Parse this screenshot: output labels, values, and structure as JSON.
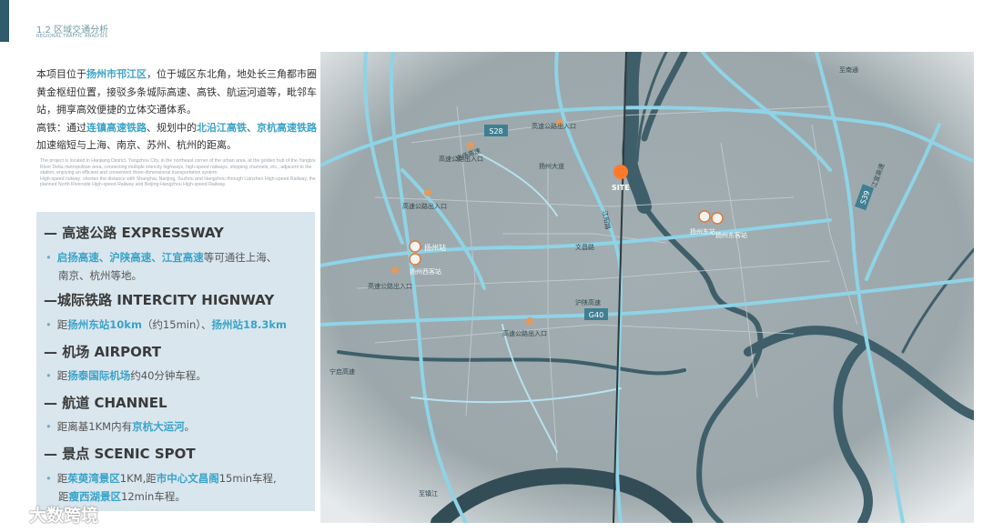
{
  "header": {
    "title": "1.2 区域交通分析",
    "subtitle": "REGIONAL TRAFFIC ANALYSIS"
  },
  "intro": {
    "p1_a": "本项目位于",
    "p1_hl": "扬州市邗江区",
    "p1_b": "，位于城区东北角，地处长三角都市圈黄金枢纽位置，接驳多条城际高速、高铁、航运河道等，毗邻车站，拥享高效便捷的立体交通体系。",
    "p2_a": "高铁：通过",
    "p2_hl1": "连镇高速铁路",
    "p2_b": "、规划中的",
    "p2_hl2": "北沿江高铁",
    "p2_c": "、",
    "p2_hl3": "京杭高速铁路",
    "p2_d": "加速缩短与上海、南京、苏州、杭州的距离。",
    "en_1": "The project is located in Hanjiang District, Yangzhou City, in the northeast corner of the urban area, at the golden hub of the Yangtze River Delta metropolitan area, connecting multiple intercity highways, high-speed railways, shipping channels, etc., adjacent to the station, enjoying an efficient and convenient three-dimensional transportation system.",
    "en_2": "High-speed railway: shorten the distance with Shanghai, Nanjing, Suzhou and Hangzhou through Lianzhen High-speed Railway, the planned North Riverside High-speed Railway and Beijing-Hangzhou High-speed Railway."
  },
  "sections": [
    {
      "heading": "— 高速公路 EXPRESSWAY",
      "line1_hl": "启扬高速、沪陕高速、江宜高速",
      "line1_b": "等可通往上海、",
      "line2": "南京、杭州等地。"
    },
    {
      "heading": "—城际铁路 INTERCITY HIGNWAY",
      "a": "距",
      "hl1": "扬州东站10km",
      "b": "（约15min）、",
      "hl2": "扬州站18.3km"
    },
    {
      "heading": "— 机场 AIRPORT",
      "a": "距",
      "hl1": "扬泰国际机场",
      "b": "约40分钟车程。"
    },
    {
      "heading": "— 航道 CHANNEL",
      "a": "距离基1KM内有",
      "hl1": "京杭大运河",
      "b": "。"
    },
    {
      "heading": "— 景点 SCENIC SPOT",
      "a": "距",
      "hl1": "茱萸湾景区",
      "b": "1KM,距",
      "hl2": "市中心文昌阁",
      "c": "15min车程,",
      "d": "距",
      "hl3": "瘦西湖景区",
      "e": "12min车程。"
    }
  ],
  "map": {
    "labels": {
      "s28": "S28",
      "s39": "S39",
      "g40": "G40",
      "qiyang": "启扬高速",
      "huishan": "沪陕高速",
      "jiangyi": "江宜高速",
      "site": "SITE",
      "yz_station": "扬州站",
      "yz_west": "扬州西客站",
      "yz_east": "扬州东站",
      "yz_east2": "扬州东客站",
      "wenchang": "文昌路",
      "ent1": "高速公路出入口",
      "ent2": "高速公路出入口",
      "ent3": "高速公路出入口",
      "ent4": "高速公路出入口",
      "ent5": "高速公路出入口",
      "ninghai": "宁启高速",
      "hutong": "扬州大道",
      "jiangyang": "江阳路",
      "suijiang": "至镇江",
      "xian_tong": "至南通",
      "to_nj": "至南通"
    }
  },
  "watermark": "大数跨境",
  "colors": {
    "accent": "#3aa3c8",
    "panel": "#d9e6ee",
    "road": "#8fd3e6",
    "map_bg": "#9aa5a8"
  }
}
